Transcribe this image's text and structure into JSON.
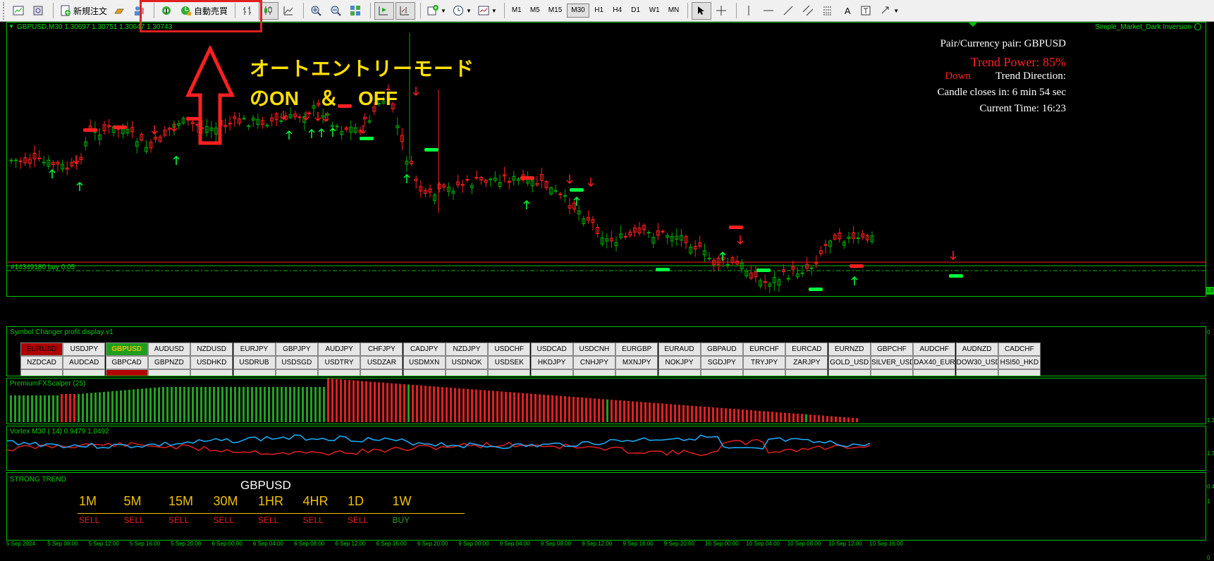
{
  "toolbar": {
    "new_order": "新規注文",
    "auto_trade": "自動売買",
    "timeframes": [
      "M1",
      "M5",
      "M15",
      "M30",
      "H1",
      "H4",
      "D1",
      "W1",
      "MN"
    ],
    "active_timeframe": "M30",
    "text_tool": "A"
  },
  "chart": {
    "header": "GBPUSD,M30  1.30697 1.30751 1.30647 1.30743",
    "template": "Simple_Market_Dark Inversion",
    "order_line": "#14349180 buy 0.05",
    "up_color": "#00aa00",
    "down_color": "#ff2020",
    "info_color": "#ffffff",
    "trend_color": "#ff2020"
  },
  "annotation": {
    "line1": "オートエントリーモード",
    "line2": "のON　＆　OFF",
    "color": "#ffe000"
  },
  "info_panel": {
    "pair": "Pair/Currency pair: GBPUSD",
    "trend_power": "Trend Power: 85%",
    "direction_value": "Down",
    "direction_label": "Trend Direction:",
    "candle_close": "Candle closes in: 6 min 54 sec",
    "current_time": "Current Time: 16:23"
  },
  "symbol_changer": {
    "title": "Symbol Changer profit display v1",
    "row1": [
      "EURUSD",
      "USDJPY",
      "GBPUSD",
      "AUDUSD",
      "NZDUSD",
      "EURJPY",
      "GBPJPY",
      "AUDJPY",
      "CHFJPY",
      "CADJPY",
      "NZDJPY",
      "USDCHF",
      "USDCAD",
      "USDCNH",
      "EURGBP",
      "EURAUD",
      "GBPAUD",
      "EURCHF",
      "EURCAD",
      "EURNZD",
      "GBPCHF",
      "AUDCHF",
      "AUDNZD",
      "CADCHF"
    ],
    "row2": [
      "NZDCAD",
      "AUDCAD",
      "GBPCAD",
      "GBPNZD",
      "USDHKD",
      "USDRUB",
      "USDSGD",
      "USDTRY",
      "USDZAR",
      "USDMXN",
      "USDNOK",
      "USDSEK",
      "HKDJPY",
      "CNHJPY",
      "MXNJPY",
      "NOKJPY",
      "SGDJPY",
      "TRYJPY",
      "ZARJPY",
      "GOLD_USD",
      "SILVER_USD",
      "DAX40_EUR",
      "DOW30_USD",
      "HSI50_HKD"
    ],
    "selected_red": "EURUSD",
    "selected_green": "GBPUSD"
  },
  "scalper": {
    "title": "PremiumFXScalper (25)",
    "green": "#22a022",
    "red": "#e02020"
  },
  "vortex": {
    "title": "Vortex M30 ( 14) 0.9479 1.0492",
    "plus_color": "#20b0ff",
    "minus_color": "#e02020"
  },
  "strong_trend": {
    "title": "STRONG TREND",
    "symbol": "GBPUSD",
    "timeframes": [
      "1M",
      "5M",
      "15M",
      "30M",
      "1HR",
      "4HR",
      "1D",
      "1W"
    ],
    "signals": [
      "SELL",
      "SELL",
      "SELL",
      "SELL",
      "SELL",
      "SELL",
      "SELL",
      "BUY"
    ],
    "tf_color": "#f0c000",
    "sell_color": "#e02020",
    "buy_color": "#22a022"
  },
  "time_axis": [
    "5 Sep 2024",
    "5 Sep 08:00",
    "5 Sep 12:00",
    "5 Sep 16:00",
    "5 Sep 20:00",
    "6 Sep 00:00",
    "6 Sep 04:00",
    "6 Sep 08:00",
    "6 Sep 12:00",
    "6 Sep 16:00",
    "6 Sep 20:00",
    "9 Sep 00:00",
    "9 Sep 04:00",
    "9 Sep 08:00",
    "9 Sep 12:00",
    "9 Sep 16:00",
    "9 Sep 20:00",
    "10 Sep 00:00",
    "10 Sep 04:00",
    "10 Sep 08:00",
    "10 Sep 12:00",
    "10 Sep 16:00"
  ],
  "price_scale": {
    "order_price": "1.3",
    "indicator_top": "0",
    "scalper_max": "1.3",
    "vortex_max": "1.3",
    "vortex_min": "0.4",
    "trend_max": "1",
    "trend_min": "0"
  }
}
